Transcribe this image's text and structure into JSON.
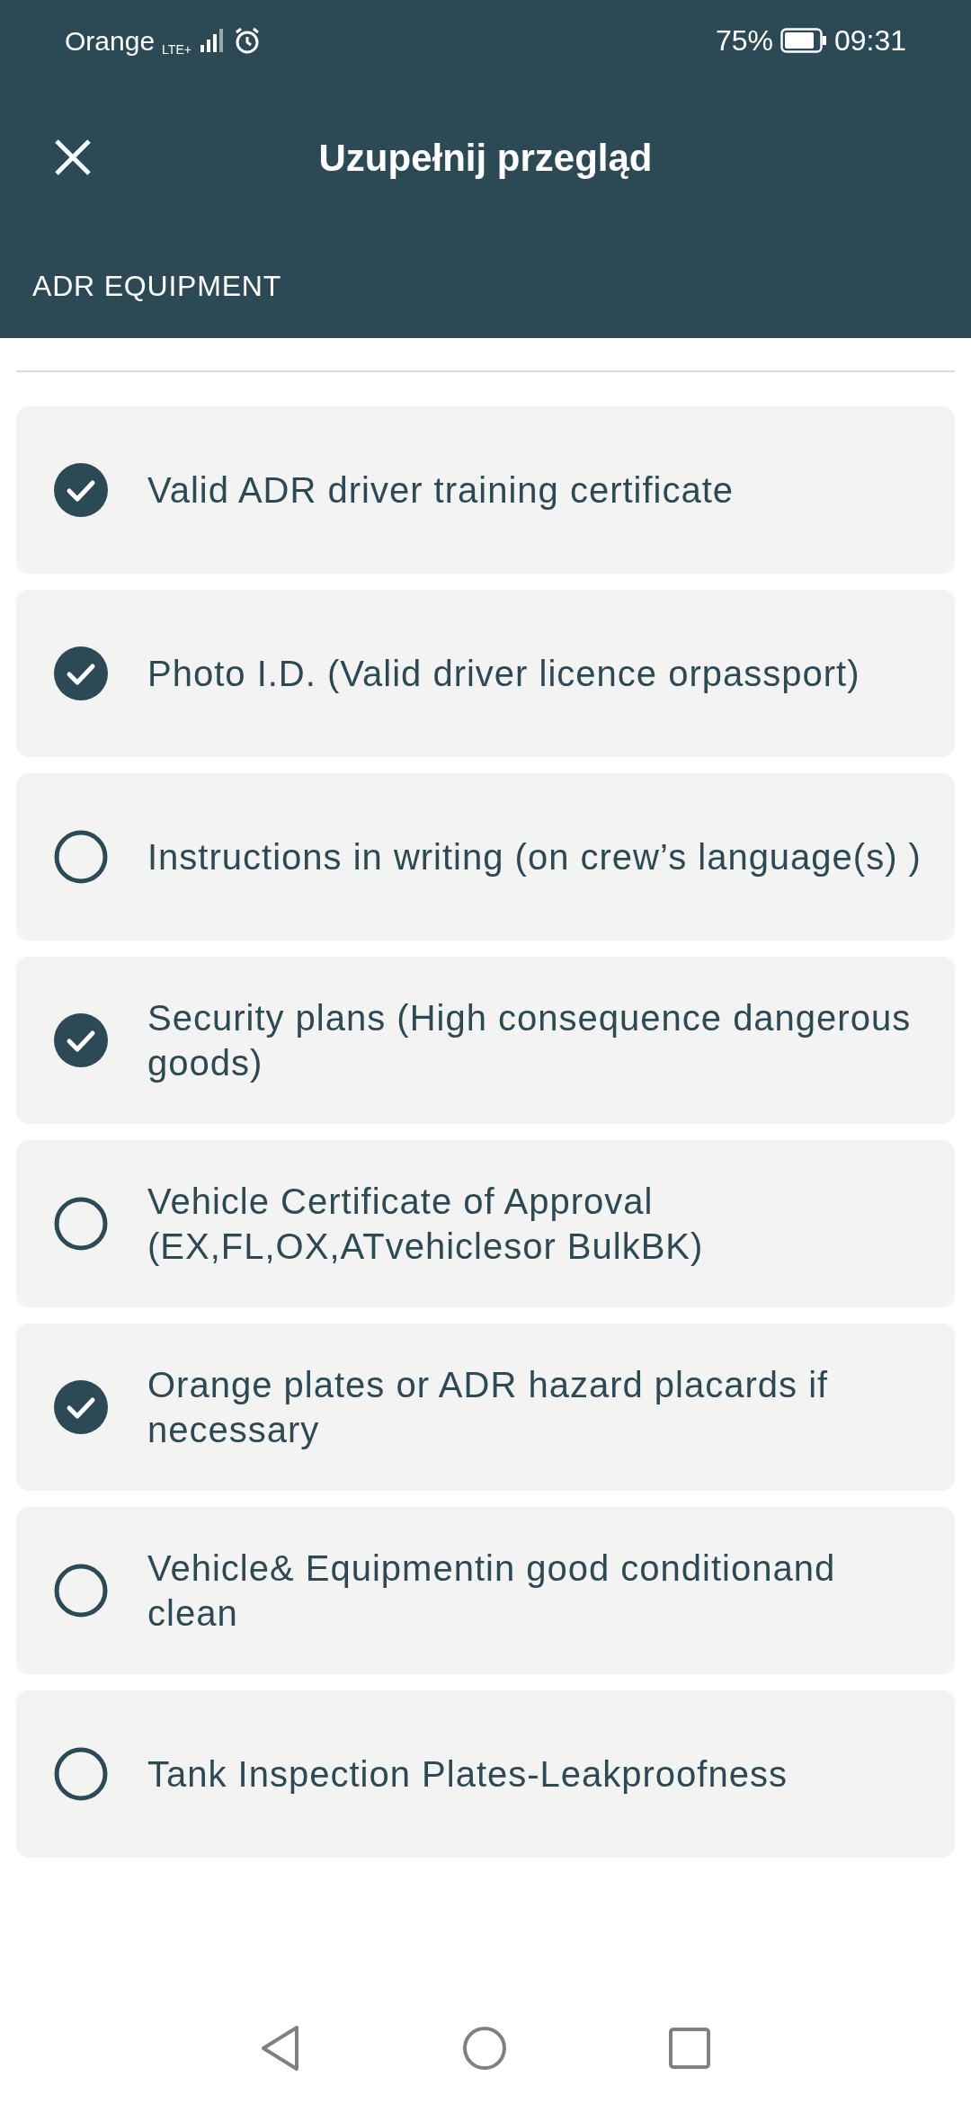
{
  "status_bar": {
    "carrier": "Orange",
    "network": "LTE+",
    "battery": "75%",
    "time": "09:31"
  },
  "header": {
    "title": "Uzupełnij przegląd",
    "section": "ADR EQUIPMENT"
  },
  "items": [
    {
      "label": "Valid ADR driver training certificate",
      "checked": true
    },
    {
      "label": "Photo I.D. (Valid driver licence orpassport)",
      "checked": true
    },
    {
      "label": "Instructions in writing (on crew’s language(s) )",
      "checked": false
    },
    {
      "label": "Security plans (High consequence dangerous goods)",
      "checked": true
    },
    {
      "label": "Vehicle Certificate of Approval (EX,FL,OX,ATvehiclesor BulkBK)",
      "checked": false
    },
    {
      "label": "Orange plates or ADR hazard placards if necessary",
      "checked": true
    },
    {
      "label": "Vehicle& Equipmentin good conditionand clean",
      "checked": false
    },
    {
      "label": "Tank Inspection Plates-Leakproofness",
      "checked": false
    }
  ]
}
